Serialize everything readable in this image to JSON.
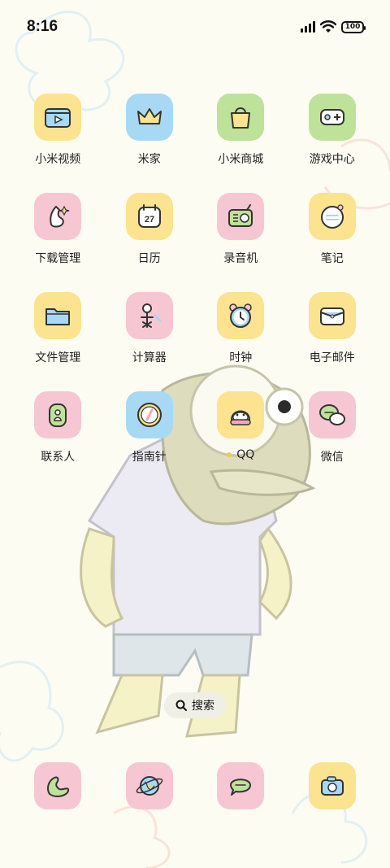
{
  "status_bar": {
    "time": "8:16",
    "battery": "100",
    "icons": [
      "signal-icon",
      "wifi-icon",
      "battery-icon"
    ]
  },
  "apps": [
    {
      "label": "小米视频",
      "icon": "video-player-icon",
      "color": "#fbe38f"
    },
    {
      "label": "米家",
      "icon": "crown-icon",
      "color": "#a7d8f4"
    },
    {
      "label": "小米商城",
      "icon": "shopping-bag-icon",
      "color": "#bfe29a"
    },
    {
      "label": "游戏中心",
      "icon": "gamepad-icon",
      "color": "#bfe29a"
    },
    {
      "label": "下载管理",
      "icon": "download-hand-icon",
      "color": "#f7c6d3"
    },
    {
      "label": "日历",
      "icon": "calendar-icon",
      "color": "#fbe38f",
      "text": "27"
    },
    {
      "label": "录音机",
      "icon": "radio-recorder-icon",
      "color": "#f7c6d3"
    },
    {
      "label": "笔记",
      "icon": "notes-icon",
      "color": "#fbe38f"
    },
    {
      "label": "文件管理",
      "icon": "folder-icon",
      "color": "#fbe38f"
    },
    {
      "label": "计算器",
      "icon": "calculator-icon",
      "color": "#f7c6d3"
    },
    {
      "label": "时钟",
      "icon": "alarm-clock-icon",
      "color": "#fbe38f"
    },
    {
      "label": "电子邮件",
      "icon": "envelope-icon",
      "color": "#fbe38f"
    },
    {
      "label": "联系人",
      "icon": "contacts-icon",
      "color": "#f7c6d3"
    },
    {
      "label": "指南针",
      "icon": "compass-icon",
      "color": "#a7d8f4"
    },
    {
      "label": "QQ",
      "icon": "qq-penguin-icon",
      "color": "#fbe38f",
      "badge_dot": true
    },
    {
      "label": "微信",
      "icon": "wechat-bubbles-icon",
      "color": "#f7c6d3"
    }
  ],
  "search": {
    "label": "搜索",
    "icon": "search-icon"
  },
  "dock": [
    {
      "icon": "phone-icon",
      "color": "#f7c6d3"
    },
    {
      "icon": "browser-planet-icon",
      "color": "#f7c6d3"
    },
    {
      "icon": "messages-bubble-icon",
      "color": "#f7c6d3"
    },
    {
      "icon": "camera-icon",
      "color": "#fbe38f"
    }
  ]
}
